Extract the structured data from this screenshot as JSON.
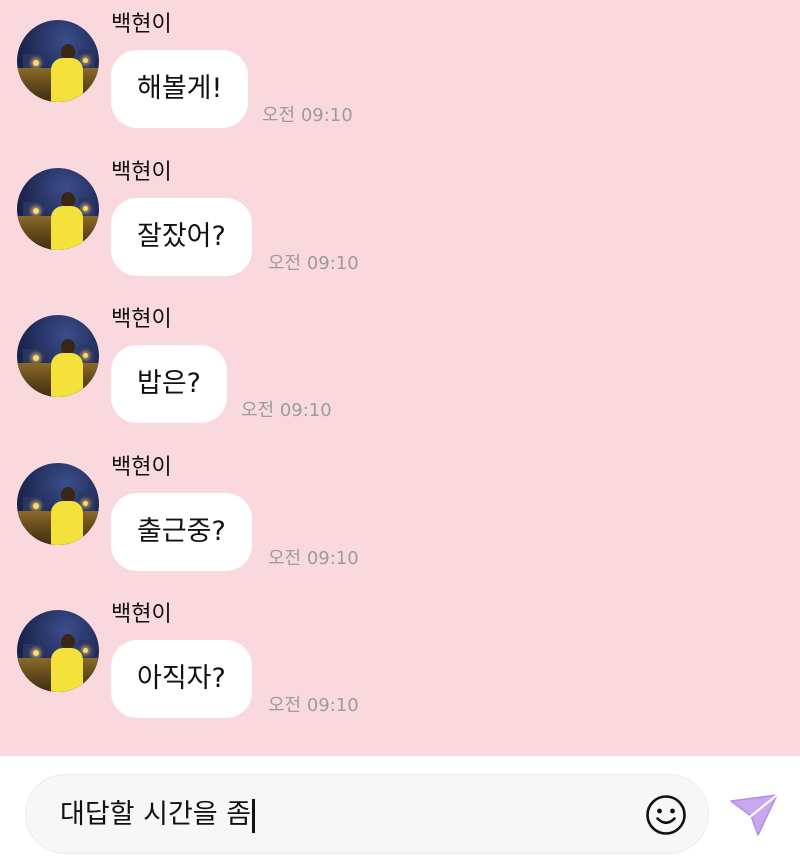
{
  "messages": [
    {
      "sender": "백현이",
      "text": "해볼게!",
      "time": "오전 09:10"
    },
    {
      "sender": "백현이",
      "text": "잘잤어?",
      "time": "오전 09:10"
    },
    {
      "sender": "백현이",
      "text": "밥은?",
      "time": "오전 09:10"
    },
    {
      "sender": "백현이",
      "text": "출근중?",
      "time": "오전 09:10"
    },
    {
      "sender": "백현이",
      "text": "아직자?",
      "time": "오전 09:10"
    }
  ],
  "composer": {
    "value": "대답할 시간을 좀",
    "emoji_icon": "smiley-face-icon",
    "send_icon": "paper-plane-icon"
  },
  "colors": {
    "chat_background": "#f9d9de",
    "bubble": "#ffffff",
    "timestamp": "#9c9c9c",
    "send_accent": "#c9a7ee"
  }
}
